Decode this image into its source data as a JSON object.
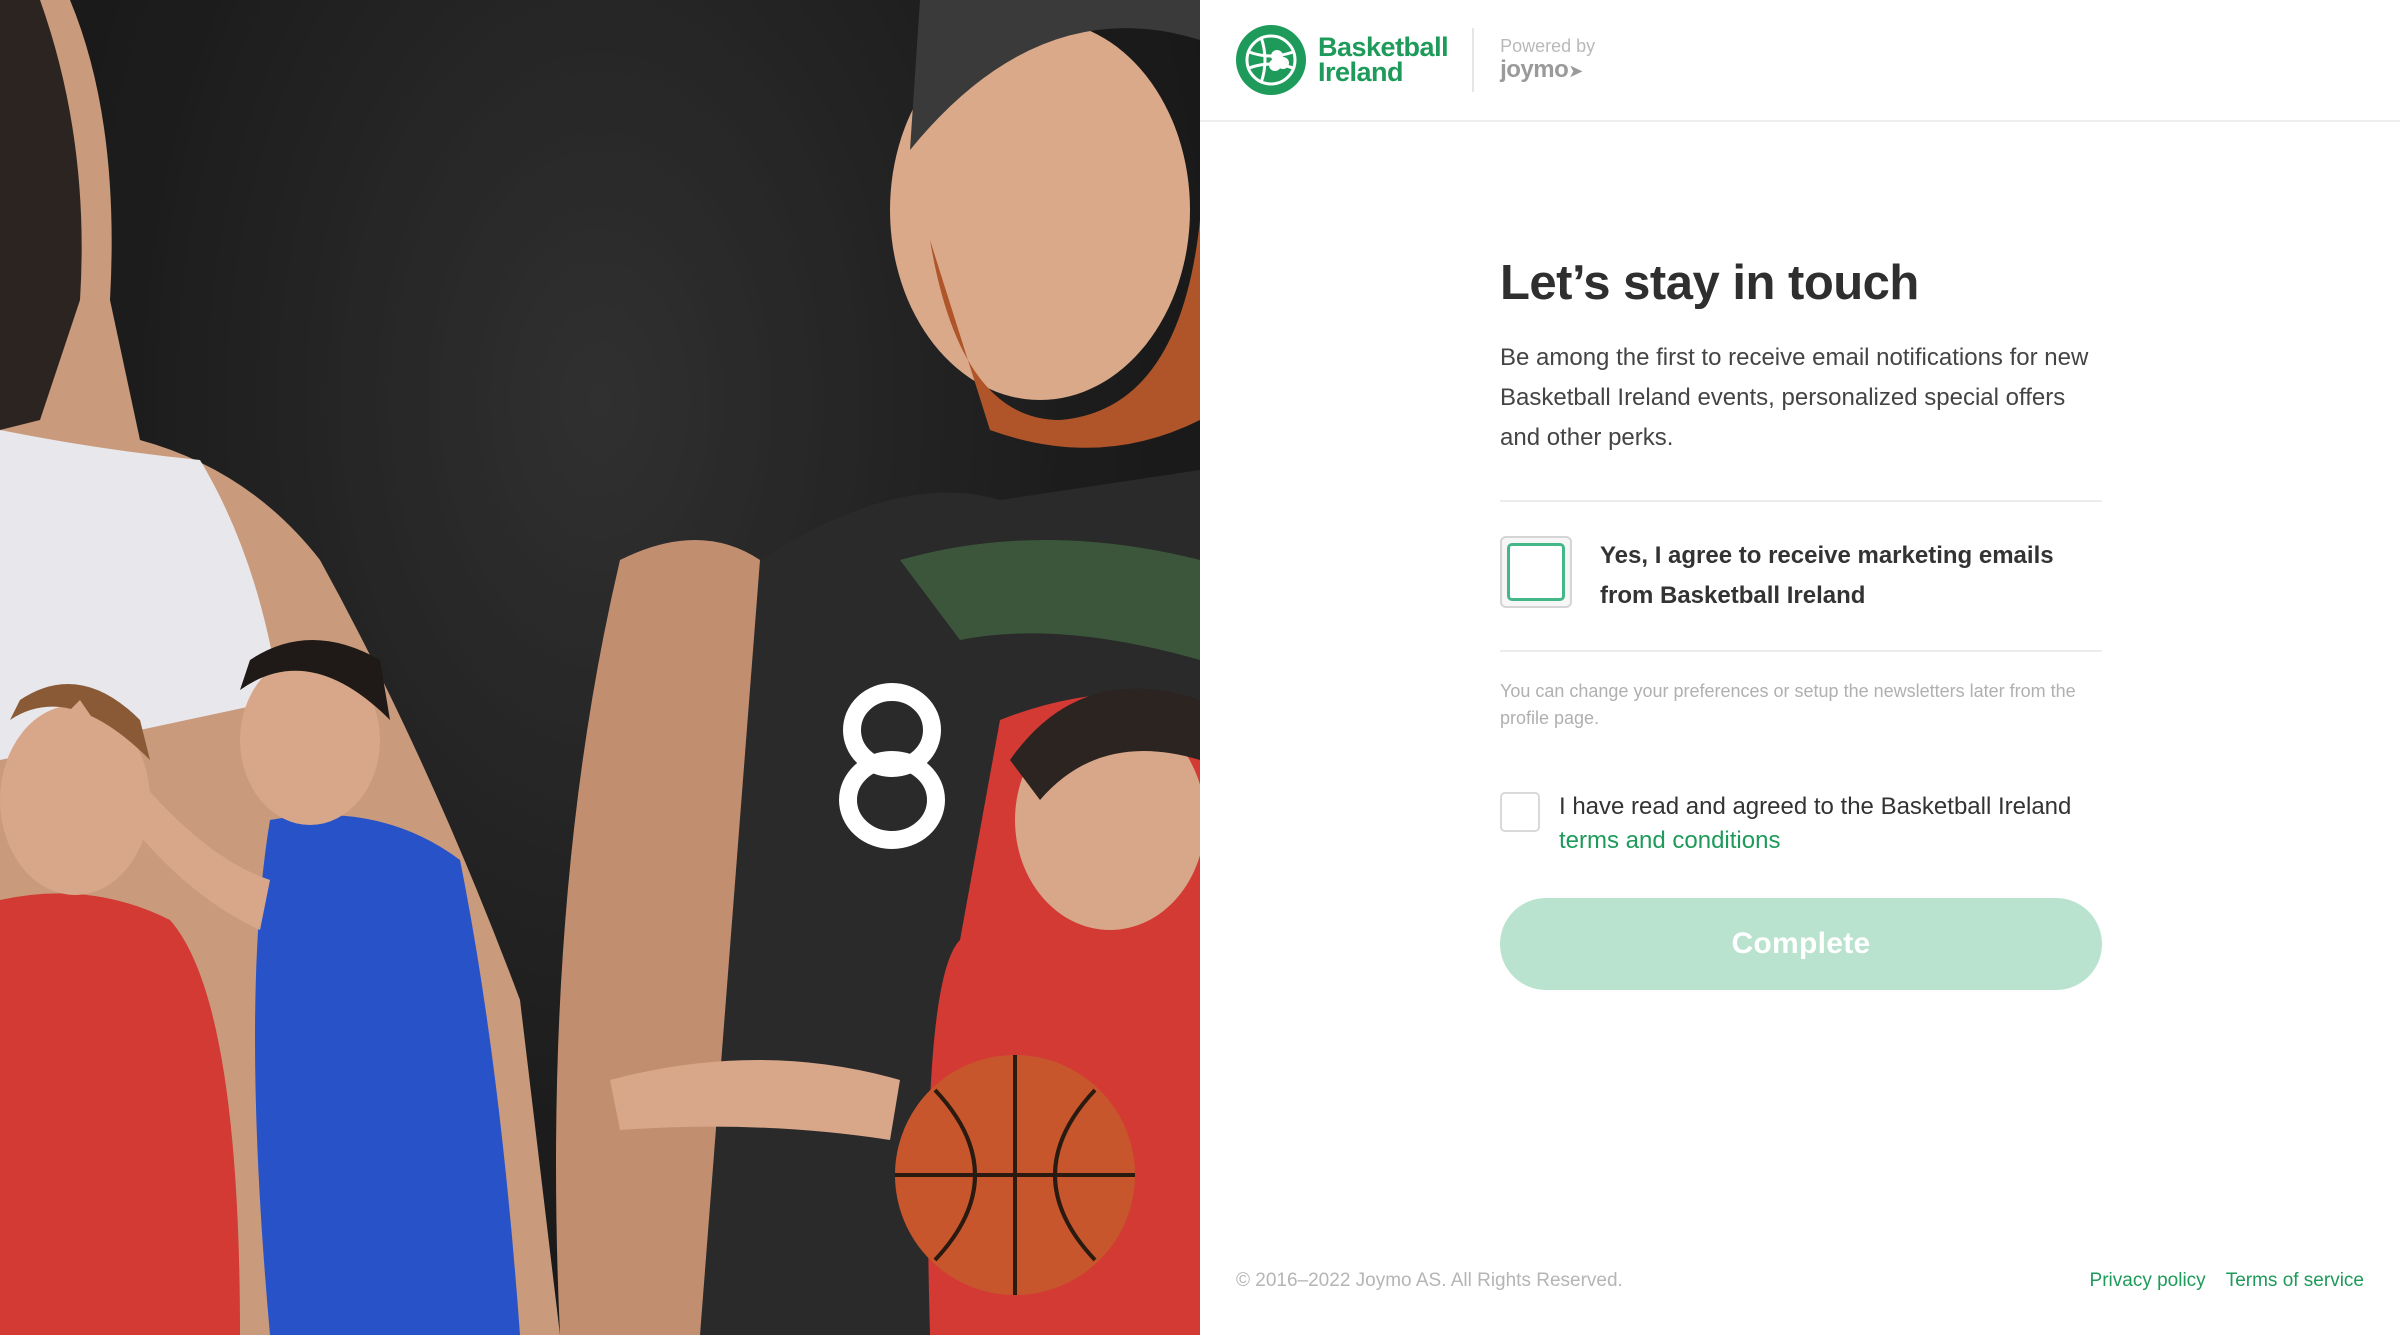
{
  "header": {
    "logo_line1": "Basketball",
    "logo_line2": "Ireland",
    "powered_by": "Powered by",
    "powered_brand": "joymo"
  },
  "form": {
    "title": "Let’s stay in touch",
    "description": "Be among the first to receive email notifications for new Basketball Ireland events, personalized special offers and other perks.",
    "marketing_consent_label": "Yes, I agree to receive marketing emails from Basketball Ireland",
    "marketing_consent_checked": false,
    "preferences_note": "You can change your preferences or setup the newsletters later from the profile page.",
    "terms_prefix": "I have read and agreed to the Basketball Ireland",
    "terms_link": "terms and conditions",
    "terms_checked": false,
    "complete_button": "Complete",
    "complete_enabled": false
  },
  "footer": {
    "copyright": "© 2016–2022 Joymo AS. All Rights Reserved.",
    "privacy_link": "Privacy policy",
    "terms_link": "Terms of service"
  },
  "colors": {
    "brand_green": "#1e9a5a",
    "button_disabled": "#b9e2cf",
    "checkbox_focus": "#44b788"
  },
  "icons": {
    "logo": "basketball-shamrock-logo",
    "joymo_arrow": "arrow-icon"
  }
}
